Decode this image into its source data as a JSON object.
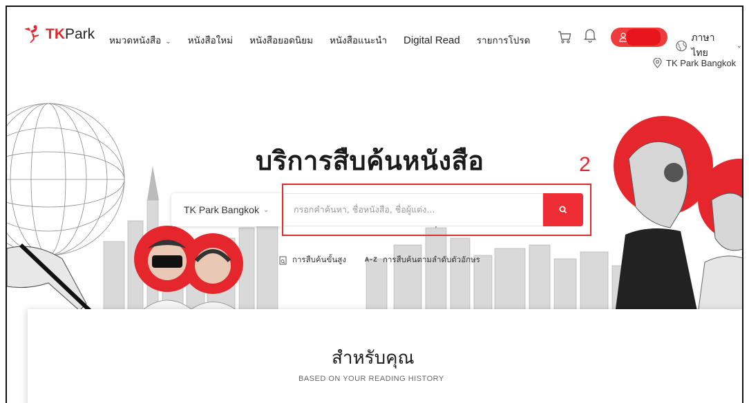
{
  "header": {
    "logo": {
      "brand_tk": "TK",
      "brand_park": "Park"
    },
    "nav": [
      {
        "label": "หมวดหนังสือ",
        "has_dropdown": true
      },
      {
        "label": "หนังสือใหม่",
        "has_dropdown": false
      },
      {
        "label": "หนังสือยอดนิยม",
        "has_dropdown": false
      },
      {
        "label": "หนังสือแนะนำ",
        "has_dropdown": false
      },
      {
        "label": "Digital Read",
        "has_dropdown": false
      },
      {
        "label": "รายการโปรด",
        "has_dropdown": false
      }
    ],
    "icons": {
      "cart": "cart-icon",
      "bell": "bell-icon",
      "user": "user-icon",
      "globe": "globe-icon",
      "pin": "location-pin-icon"
    },
    "language": "ภาษาไทย",
    "location": "TK Park Bangkok"
  },
  "hero": {
    "title": "บริการสืบค้นหนังสือ",
    "annotation_number": "2",
    "branch_select": "TK Park Bangkok",
    "search_placeholder": "กรอกคำค้นหา, ชื่อหนังสือ, ชื่อผู้แต่ง...",
    "advanced_search": "การสืบค้นขั้นสูง",
    "az_tag": "A-Z",
    "az_search": "การสืบค้นตามลำดับตัวอักษร"
  },
  "section": {
    "title": "สำหรับคุณ",
    "subtitle": "BASED ON YOUR READING HISTORY"
  },
  "colors": {
    "brand_red": "#e5262c",
    "button_red": "#ee2d35",
    "annotation_red": "#e0282e"
  }
}
